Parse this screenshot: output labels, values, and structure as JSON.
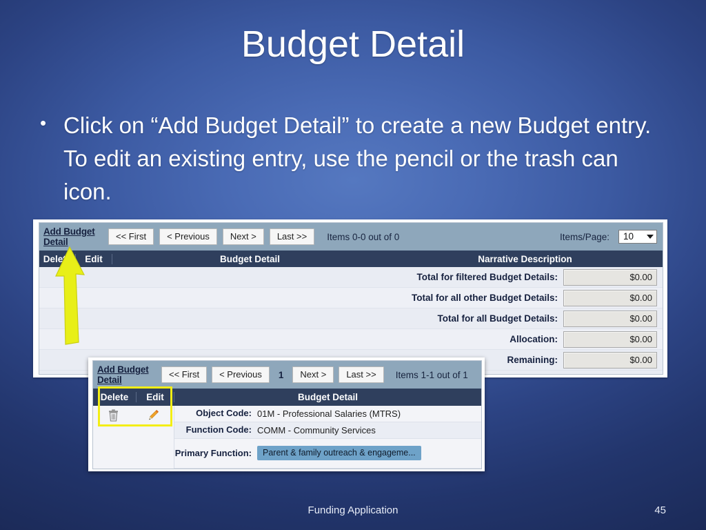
{
  "slide": {
    "title": "Budget Detail",
    "bullet_marker": "•",
    "bullet_text": "Click on “Add Budget Detail” to create a new Budget entry. To edit an existing entry, use the pencil or the trash can icon.",
    "footer_title": "Funding Application",
    "footer_page": "45",
    "accent_highlight_color": "#f3ee15",
    "header_row_color": "#2f3f5d",
    "toolbar_color": "#8ea7bb"
  },
  "main_panel": {
    "toolbar": {
      "add_link": "Add Budget Detail",
      "first_button": "<< First",
      "previous_button": "< Previous",
      "next_button": "Next >",
      "last_button": "Last >>",
      "items_count": "Items 0-0 out of 0",
      "items_per_page_label": "Items/Page:",
      "items_per_page_value": "10"
    },
    "columns": {
      "delete": "Delete",
      "edit": "Edit",
      "budget_detail": "Budget Detail",
      "narrative_description": "Narrative Description"
    },
    "totals": [
      {
        "label": "Total for filtered Budget Details:",
        "value": "$0.00"
      },
      {
        "label": "Total for all other Budget Details:",
        "value": "$0.00"
      },
      {
        "label": "Total for all Budget Details:",
        "value": "$0.00"
      },
      {
        "label": "Allocation:",
        "value": "$0.00"
      },
      {
        "label": "Remaining:",
        "value": "$0.00"
      }
    ]
  },
  "inset_panel": {
    "toolbar": {
      "add_link": "Add Budget Detail",
      "first_button": "<< First",
      "previous_button": "< Previous",
      "page_number": "1",
      "next_button": "Next >",
      "last_button": "Last >>",
      "items_count": "Items 1-1 out of 1"
    },
    "columns": {
      "delete": "Delete",
      "edit": "Edit",
      "budget_detail": "Budget Detail"
    },
    "record": {
      "object_code_label": "Object Code:",
      "object_code_value": "01M - Professional Salaries (MTRS)",
      "function_code_label": "Function Code:",
      "function_code_value": "COMM - Community Services",
      "primary_function_label": "Primary Function:",
      "primary_function_value": "Parent & family outreach & engageme..."
    }
  }
}
